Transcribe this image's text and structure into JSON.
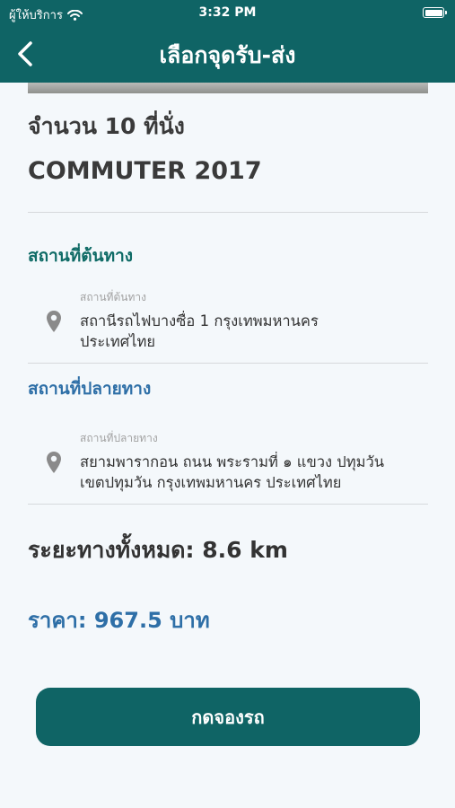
{
  "status_bar": {
    "carrier": "ผู้ให้บริการ",
    "time": "3:32 PM",
    "wifi_icon": "wifi-icon",
    "battery_icon": "battery-icon"
  },
  "nav": {
    "title": "เลือกจุดรับ-ส่ง",
    "back_icon": "chevron-left-icon"
  },
  "vehicle": {
    "seats": "จำนวน 10 ที่นั่ง",
    "model": "COMMUTER 2017"
  },
  "origin": {
    "section_title": "สถานที่ต้นทาง",
    "caption": "สถานที่ต้นทาง",
    "address_line1": "สถานีรถไฟบางซื่อ 1 กรุงเทพมหานคร",
    "address_line2": "ประเทศไทย",
    "icon": "location-pin-icon"
  },
  "destination": {
    "section_title": "สถานที่ปลายทาง",
    "caption": "สถานที่ปลายทาง",
    "address_line1": "สยามพารากอน ถนน พระรามที่ ๑ แขวง ปทุมวัน",
    "address_line2": "เขตปทุมวัน กรุงเทพมหานคร ประเทศไทย",
    "icon": "location-pin-icon"
  },
  "summary": {
    "distance": "ระยะทางทั้งหมด:  8.6 km",
    "price": "ราคา: 967.5 บาท"
  },
  "book_button": {
    "label": "กดจองรถ"
  },
  "colors": {
    "header": "#0f6465",
    "origin_title": "#0f6b66",
    "destination_title": "#2e6fa7",
    "price": "#2e6fa7",
    "button": "#0f6465"
  }
}
